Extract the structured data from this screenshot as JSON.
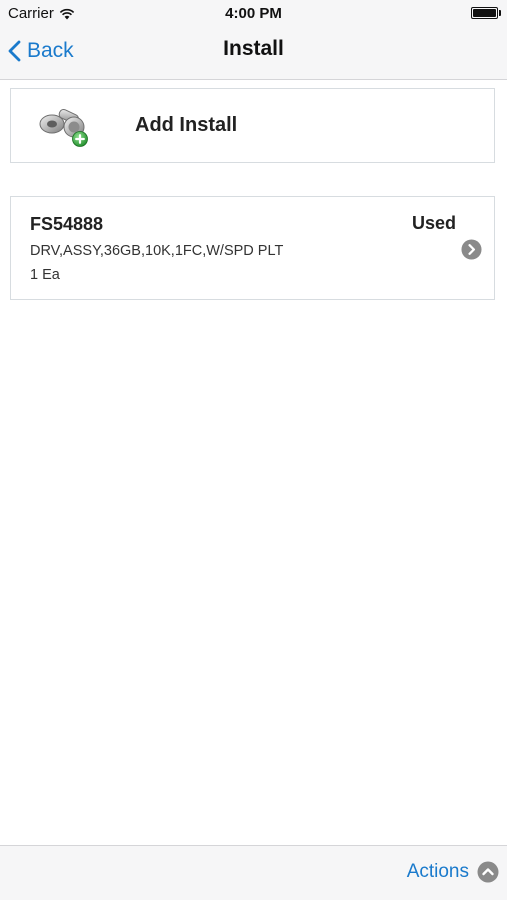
{
  "status_bar": {
    "carrier": "Carrier",
    "time": "4:00 PM",
    "icons": [
      "wifi-icon",
      "battery-icon"
    ]
  },
  "nav": {
    "back_label": "Back",
    "title": "Install"
  },
  "add_install": {
    "label": "Add Install",
    "icon": "add-install-icon"
  },
  "items": [
    {
      "part_number": "FS54888",
      "status": "Used",
      "description": "DRV,ASSY,36GB,10K,1FC,W/SPD PLT",
      "quantity": "1 Ea"
    }
  ],
  "toolbar": {
    "actions_label": "Actions"
  },
  "colors": {
    "accent": "#1a7acc",
    "bar_background": "#f6f6f7",
    "card_border": "#d7dce0",
    "chevron_gray": "#8a8a8a",
    "badge_green": "#3aa33a"
  }
}
